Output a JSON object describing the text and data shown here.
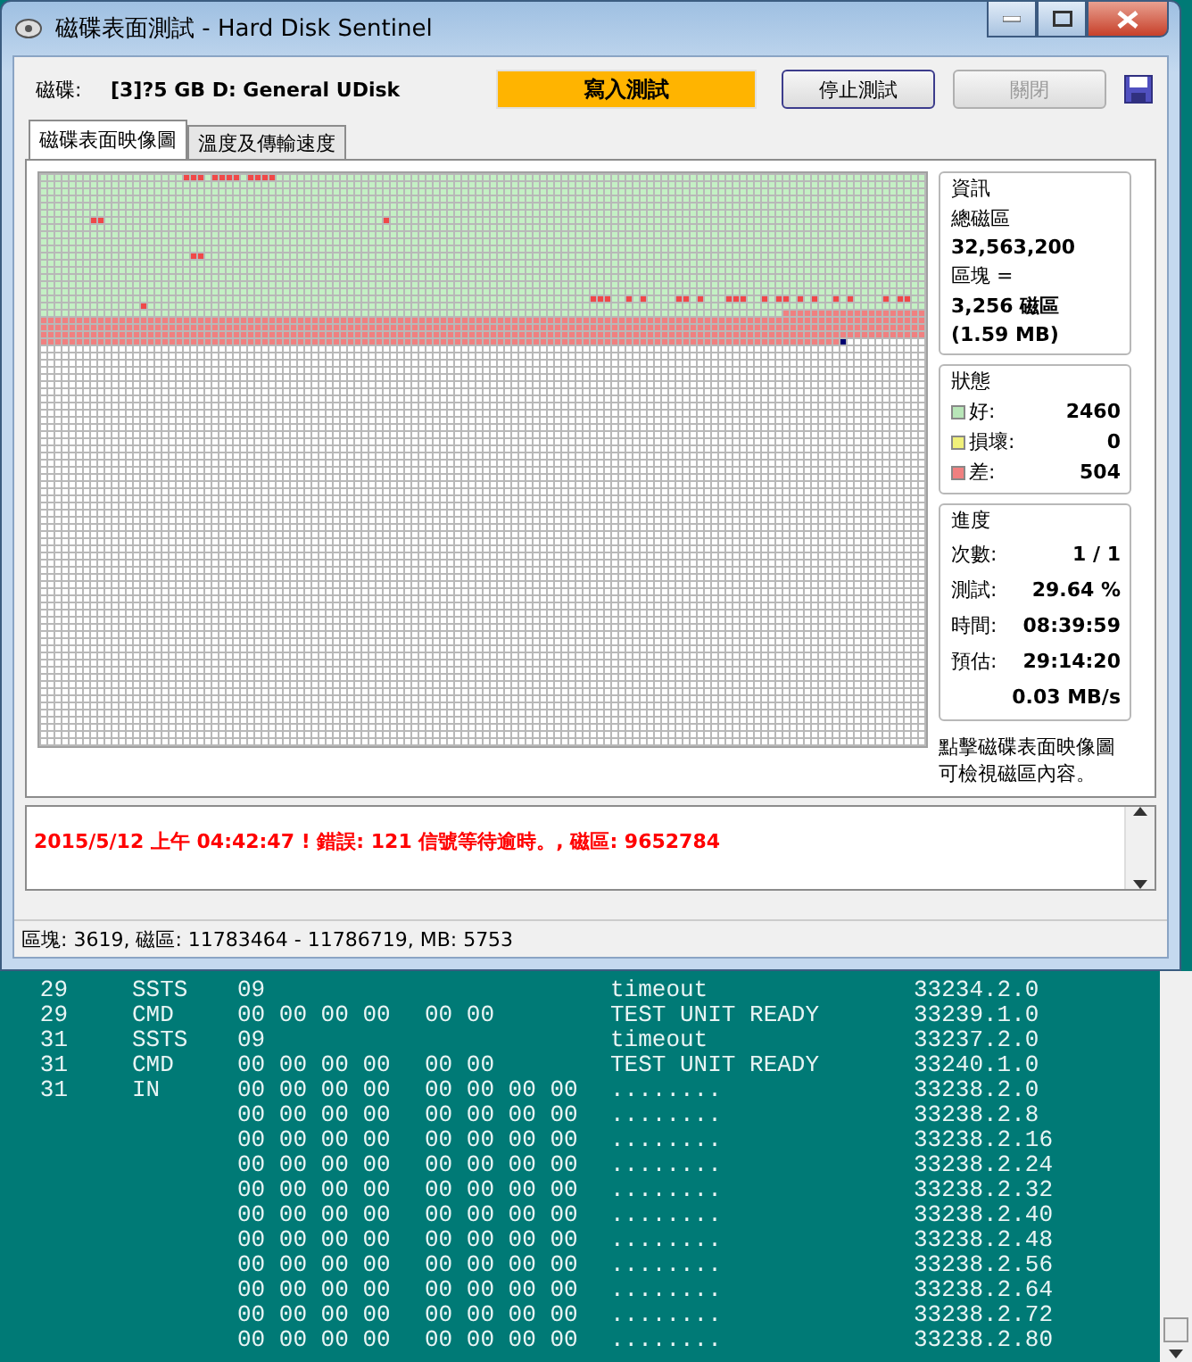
{
  "window": {
    "title": "磁碟表面測試 - Hard Disk Sentinel"
  },
  "toolbar": {
    "drive_label": "磁碟:",
    "drive_name": "[3]?5 GB D: General UDisk",
    "mode": "寫入測試",
    "buttons": [
      {
        "label": "停止測試",
        "disabled": false
      },
      {
        "label": "關閉",
        "disabled": true
      }
    ]
  },
  "tabs": [
    {
      "label": "磁碟表面映像圖",
      "selected": true
    },
    {
      "label": "溫度及傳輸速度",
      "selected": false
    }
  ],
  "info": {
    "title": "資訊",
    "total_label": "總磁區",
    "total_value": "32,563,200",
    "block_label": "區塊 =",
    "block_value": "3,256 磁區",
    "block_size": "(1.59 MB)"
  },
  "status": {
    "title": "狀態",
    "items": [
      {
        "label": "好:",
        "value": "2460",
        "color": "#b8e6b8"
      },
      {
        "label": "損壞:",
        "value": "0",
        "color": "#f0f07a"
      },
      {
        "label": "差:",
        "value": "504",
        "color": "#f08080"
      }
    ]
  },
  "progress": {
    "title": "進度",
    "items": [
      {
        "label": "次數:",
        "value": "1 / 1"
      },
      {
        "label": "測試:",
        "value": "29.64 %"
      },
      {
        "label": "時間:",
        "value": "08:39:59"
      },
      {
        "label": "預估:",
        "value": "29:14:20"
      },
      {
        "value": "0.03 MB/s"
      }
    ]
  },
  "hint": "點擊磁碟表面映像圖可檢視磁區內容。",
  "log": [
    "2015/5/12  上午 04:42:47 ! 錯誤: 121 信號等待逾時。, 磁區: 9652784"
  ],
  "status_bar": "區塊: 3619, 磁區: 11783464 - 11786719, MB: 5753",
  "terminal": [
    {
      "id": "29",
      "type": "SSTS",
      "hex_1": "09",
      "desc": "timeout",
      "ref": "33234.2.0"
    },
    {
      "id": "29",
      "type": "CMD",
      "hex_1": "00 00 00 00",
      "hex_2": "00 00",
      "desc": "TEST UNIT READY",
      "ref": "33239.1.0"
    },
    {
      "id": "31",
      "type": "SSTS",
      "hex_1": "09",
      "desc": "timeout",
      "ref": "33237.2.0"
    },
    {
      "id": "31",
      "type": "CMD",
      "hex_1": "00 00 00 00",
      "hex_2": "00 00",
      "desc": "TEST UNIT READY",
      "ref": "33240.1.0"
    },
    {
      "id": "31",
      "type": "IN",
      "hex_1": "00 00 00 00",
      "hex_2": "00 00 00 00",
      "desc": "........",
      "ref": "33238.2.0"
    },
    {
      "hex_1": "00 00 00 00",
      "hex_2": "00 00 00 00",
      "desc": "........",
      "ref": "33238.2.8"
    },
    {
      "hex_1": "00 00 00 00",
      "hex_2": "00 00 00 00",
      "desc": "........",
      "ref": "33238.2.16"
    },
    {
      "hex_1": "00 00 00 00",
      "hex_2": "00 00 00 00",
      "desc": "........",
      "ref": "33238.2.24"
    },
    {
      "hex_1": "00 00 00 00",
      "hex_2": "00 00 00 00",
      "desc": "........",
      "ref": "33238.2.32"
    },
    {
      "hex_1": "00 00 00 00",
      "hex_2": "00 00 00 00",
      "desc": "........",
      "ref": "33238.2.40"
    },
    {
      "hex_1": "00 00 00 00",
      "hex_2": "00 00 00 00",
      "desc": "........",
      "ref": "33238.2.48"
    },
    {
      "hex_1": "00 00 00 00",
      "hex_2": "00 00 00 00",
      "desc": "........",
      "ref": "33238.2.56"
    },
    {
      "hex_1": "00 00 00 00",
      "hex_2": "00 00 00 00",
      "desc": "........",
      "ref": "33238.2.64"
    },
    {
      "hex_1": "00 00 00 00",
      "hex_2": "00 00 00 00",
      "desc": "........",
      "ref": "33238.2.72"
    },
    {
      "hex_1": "00 00 00 00",
      "hex_2": "00 00 00 00",
      "desc": "........",
      "ref": "33238.2.80"
    }
  ]
}
